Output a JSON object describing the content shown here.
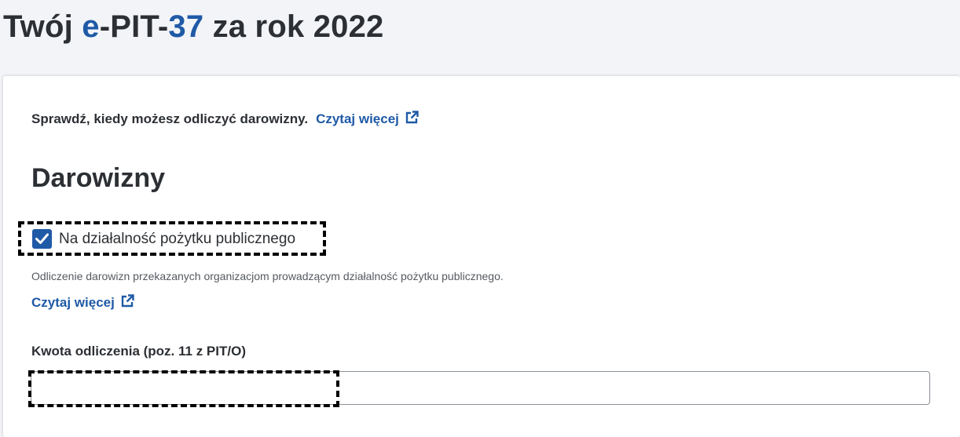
{
  "header": {
    "title_prefix": "Twój ",
    "title_accent_e": "e",
    "title_mid": "-PIT-",
    "title_accent_num": "37",
    "title_suffix": " za rok 2022"
  },
  "info": {
    "text": "Sprawdź, kiedy możesz odliczyć darowizny.",
    "link_label": "Czytaj więcej",
    "link_icon": "external-link-icon"
  },
  "section": {
    "title": "Darowizny",
    "checkbox": {
      "label": "Na działalność pożytku publicznego",
      "checked": true,
      "icon": "checkmark-icon"
    },
    "helper_text": "Odliczenie darowizn przekazanych organizacjom prowadzącym działalność pożytku publicznego.",
    "readmore_label": "Czytaj więcej",
    "readmore_icon": "external-link-icon",
    "amount_field": {
      "label": "Kwota odliczenia (poz. 11 z PIT/O)",
      "value": "",
      "placeholder": ""
    }
  },
  "colors": {
    "accent": "#1f5aa6",
    "text": "#2c2f33",
    "background": "#f2f4f8",
    "highlight_border": "#000000"
  }
}
